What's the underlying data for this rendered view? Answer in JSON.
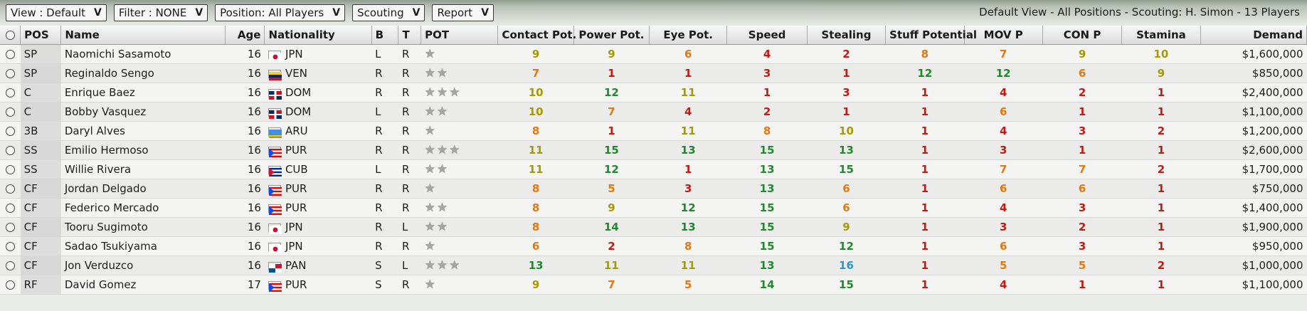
{
  "toolbar": {
    "view": "View : Default",
    "filter": "Filter : NONE",
    "position": "Position: All Players",
    "scouting": "Scouting",
    "report": "Report",
    "summary": "Default View - All Positions - Scouting: H. Simon - 13 Players"
  },
  "columns": {
    "pos": "POS",
    "name": "Name",
    "age": "Age",
    "nationality": "Nationality",
    "b": "B",
    "t": "T",
    "pot": "POT",
    "contact": "Contact Pot.",
    "power": "Power Pot.",
    "eye": "Eye Pot.",
    "speed": "Speed",
    "stealing": "Stealing",
    "stuff": "Stuff Potential",
    "mov": "MOV P",
    "con": "CON P",
    "stamina": "Stamina",
    "demand": "Demand"
  },
  "ratingColors": {
    "red": "#c01a13",
    "orange": "#e2780f",
    "olive": "#a79a00",
    "green": "#1f8a2c",
    "blue": "#2f95c6"
  },
  "players": [
    {
      "pos": "SP",
      "name": "Naomichi Sasamoto",
      "age": "16",
      "nat": "JPN",
      "flag": "jpn",
      "b": "L",
      "t": "R",
      "pot": 1,
      "ratings": [
        {
          "v": "9",
          "c": "olive"
        },
        {
          "v": "9",
          "c": "olive"
        },
        {
          "v": "6",
          "c": "orange"
        },
        {
          "v": "4",
          "c": "red"
        },
        {
          "v": "2",
          "c": "red"
        },
        {
          "v": "8",
          "c": "orange"
        },
        {
          "v": "7",
          "c": "orange"
        },
        {
          "v": "9",
          "c": "olive"
        },
        {
          "v": "10",
          "c": "olive"
        }
      ],
      "demand": "$1,600,000"
    },
    {
      "pos": "SP",
      "name": "Reginaldo Sengo",
      "age": "16",
      "nat": "VEN",
      "flag": "ven",
      "b": "R",
      "t": "R",
      "pot": 2,
      "ratings": [
        {
          "v": "7",
          "c": "orange"
        },
        {
          "v": "1",
          "c": "red"
        },
        {
          "v": "1",
          "c": "red"
        },
        {
          "v": "3",
          "c": "red"
        },
        {
          "v": "1",
          "c": "red"
        },
        {
          "v": "12",
          "c": "green"
        },
        {
          "v": "12",
          "c": "green"
        },
        {
          "v": "6",
          "c": "orange"
        },
        {
          "v": "9",
          "c": "olive"
        }
      ],
      "demand": "$850,000"
    },
    {
      "pos": "C",
      "name": "Enrique Baez",
      "age": "16",
      "nat": "DOM",
      "flag": "dom",
      "b": "R",
      "t": "R",
      "pot": 3,
      "ratings": [
        {
          "v": "10",
          "c": "olive"
        },
        {
          "v": "12",
          "c": "green"
        },
        {
          "v": "11",
          "c": "olive"
        },
        {
          "v": "1",
          "c": "red"
        },
        {
          "v": "3",
          "c": "red"
        },
        {
          "v": "1",
          "c": "red"
        },
        {
          "v": "4",
          "c": "red"
        },
        {
          "v": "2",
          "c": "red"
        },
        {
          "v": "1",
          "c": "red"
        }
      ],
      "demand": "$2,400,000"
    },
    {
      "pos": "C",
      "name": "Bobby Vasquez",
      "age": "16",
      "nat": "DOM",
      "flag": "dom",
      "b": "L",
      "t": "R",
      "pot": 2,
      "ratings": [
        {
          "v": "10",
          "c": "olive"
        },
        {
          "v": "7",
          "c": "orange"
        },
        {
          "v": "4",
          "c": "red"
        },
        {
          "v": "2",
          "c": "red"
        },
        {
          "v": "1",
          "c": "red"
        },
        {
          "v": "1",
          "c": "red"
        },
        {
          "v": "6",
          "c": "orange"
        },
        {
          "v": "1",
          "c": "red"
        },
        {
          "v": "1",
          "c": "red"
        }
      ],
      "demand": "$1,100,000"
    },
    {
      "pos": "3B",
      "name": "Daryl Alves",
      "age": "16",
      "nat": "ARU",
      "flag": "aru",
      "b": "R",
      "t": "R",
      "pot": 1,
      "ratings": [
        {
          "v": "8",
          "c": "orange"
        },
        {
          "v": "1",
          "c": "red"
        },
        {
          "v": "11",
          "c": "olive"
        },
        {
          "v": "8",
          "c": "orange"
        },
        {
          "v": "10",
          "c": "olive"
        },
        {
          "v": "1",
          "c": "red"
        },
        {
          "v": "4",
          "c": "red"
        },
        {
          "v": "3",
          "c": "red"
        },
        {
          "v": "2",
          "c": "red"
        }
      ],
      "demand": "$1,200,000"
    },
    {
      "pos": "SS",
      "name": "Emilio Hermoso",
      "age": "16",
      "nat": "PUR",
      "flag": "pur",
      "b": "R",
      "t": "R",
      "pot": 3,
      "ratings": [
        {
          "v": "11",
          "c": "olive"
        },
        {
          "v": "15",
          "c": "green"
        },
        {
          "v": "13",
          "c": "green"
        },
        {
          "v": "15",
          "c": "green"
        },
        {
          "v": "13",
          "c": "green"
        },
        {
          "v": "1",
          "c": "red"
        },
        {
          "v": "3",
          "c": "red"
        },
        {
          "v": "1",
          "c": "red"
        },
        {
          "v": "1",
          "c": "red"
        }
      ],
      "demand": "$2,600,000"
    },
    {
      "pos": "SS",
      "name": "Willie Rivera",
      "age": "16",
      "nat": "CUB",
      "flag": "cub",
      "b": "L",
      "t": "R",
      "pot": 2,
      "ratings": [
        {
          "v": "11",
          "c": "olive"
        },
        {
          "v": "12",
          "c": "green"
        },
        {
          "v": "1",
          "c": "red"
        },
        {
          "v": "13",
          "c": "green"
        },
        {
          "v": "15",
          "c": "green"
        },
        {
          "v": "1",
          "c": "red"
        },
        {
          "v": "7",
          "c": "orange"
        },
        {
          "v": "7",
          "c": "orange"
        },
        {
          "v": "2",
          "c": "red"
        }
      ],
      "demand": "$1,700,000"
    },
    {
      "pos": "CF",
      "name": "Jordan Delgado",
      "age": "16",
      "nat": "PUR",
      "flag": "pur",
      "b": "R",
      "t": "R",
      "pot": 1,
      "ratings": [
        {
          "v": "8",
          "c": "orange"
        },
        {
          "v": "5",
          "c": "orange"
        },
        {
          "v": "3",
          "c": "red"
        },
        {
          "v": "13",
          "c": "green"
        },
        {
          "v": "6",
          "c": "orange"
        },
        {
          "v": "1",
          "c": "red"
        },
        {
          "v": "6",
          "c": "orange"
        },
        {
          "v": "6",
          "c": "orange"
        },
        {
          "v": "1",
          "c": "red"
        }
      ],
      "demand": "$750,000"
    },
    {
      "pos": "CF",
      "name": "Federico Mercado",
      "age": "16",
      "nat": "PUR",
      "flag": "pur",
      "b": "R",
      "t": "R",
      "pot": 2,
      "ratings": [
        {
          "v": "8",
          "c": "orange"
        },
        {
          "v": "9",
          "c": "olive"
        },
        {
          "v": "12",
          "c": "green"
        },
        {
          "v": "15",
          "c": "green"
        },
        {
          "v": "6",
          "c": "orange"
        },
        {
          "v": "1",
          "c": "red"
        },
        {
          "v": "4",
          "c": "red"
        },
        {
          "v": "3",
          "c": "red"
        },
        {
          "v": "1",
          "c": "red"
        }
      ],
      "demand": "$1,400,000"
    },
    {
      "pos": "CF",
      "name": "Tooru Sugimoto",
      "age": "16",
      "nat": "JPN",
      "flag": "jpn",
      "b": "R",
      "t": "L",
      "pot": 2,
      "ratings": [
        {
          "v": "8",
          "c": "orange"
        },
        {
          "v": "14",
          "c": "green"
        },
        {
          "v": "13",
          "c": "green"
        },
        {
          "v": "15",
          "c": "green"
        },
        {
          "v": "9",
          "c": "olive"
        },
        {
          "v": "1",
          "c": "red"
        },
        {
          "v": "3",
          "c": "red"
        },
        {
          "v": "2",
          "c": "red"
        },
        {
          "v": "1",
          "c": "red"
        }
      ],
      "demand": "$1,900,000"
    },
    {
      "pos": "CF",
      "name": "Sadao Tsukiyama",
      "age": "16",
      "nat": "JPN",
      "flag": "jpn",
      "b": "R",
      "t": "R",
      "pot": 1,
      "ratings": [
        {
          "v": "6",
          "c": "orange"
        },
        {
          "v": "2",
          "c": "red"
        },
        {
          "v": "8",
          "c": "orange"
        },
        {
          "v": "15",
          "c": "green"
        },
        {
          "v": "12",
          "c": "green"
        },
        {
          "v": "1",
          "c": "red"
        },
        {
          "v": "6",
          "c": "orange"
        },
        {
          "v": "3",
          "c": "red"
        },
        {
          "v": "1",
          "c": "red"
        }
      ],
      "demand": "$950,000"
    },
    {
      "pos": "CF",
      "name": "Jon Verduzco",
      "age": "16",
      "nat": "PAN",
      "flag": "pan",
      "b": "S",
      "t": "L",
      "pot": 3,
      "ratings": [
        {
          "v": "13",
          "c": "green"
        },
        {
          "v": "11",
          "c": "olive"
        },
        {
          "v": "11",
          "c": "olive"
        },
        {
          "v": "13",
          "c": "green"
        },
        {
          "v": "16",
          "c": "blue"
        },
        {
          "v": "1",
          "c": "red"
        },
        {
          "v": "5",
          "c": "orange"
        },
        {
          "v": "5",
          "c": "orange"
        },
        {
          "v": "2",
          "c": "red"
        }
      ],
      "demand": "$1,000,000"
    },
    {
      "pos": "RF",
      "name": "David Gomez",
      "age": "17",
      "nat": "PUR",
      "flag": "pur",
      "b": "S",
      "t": "R",
      "pot": 1,
      "ratings": [
        {
          "v": "9",
          "c": "olive"
        },
        {
          "v": "7",
          "c": "orange"
        },
        {
          "v": "5",
          "c": "orange"
        },
        {
          "v": "14",
          "c": "green"
        },
        {
          "v": "15",
          "c": "green"
        },
        {
          "v": "1",
          "c": "red"
        },
        {
          "v": "4",
          "c": "red"
        },
        {
          "v": "1",
          "c": "red"
        },
        {
          "v": "1",
          "c": "red"
        }
      ],
      "demand": "$1,100,000"
    }
  ]
}
